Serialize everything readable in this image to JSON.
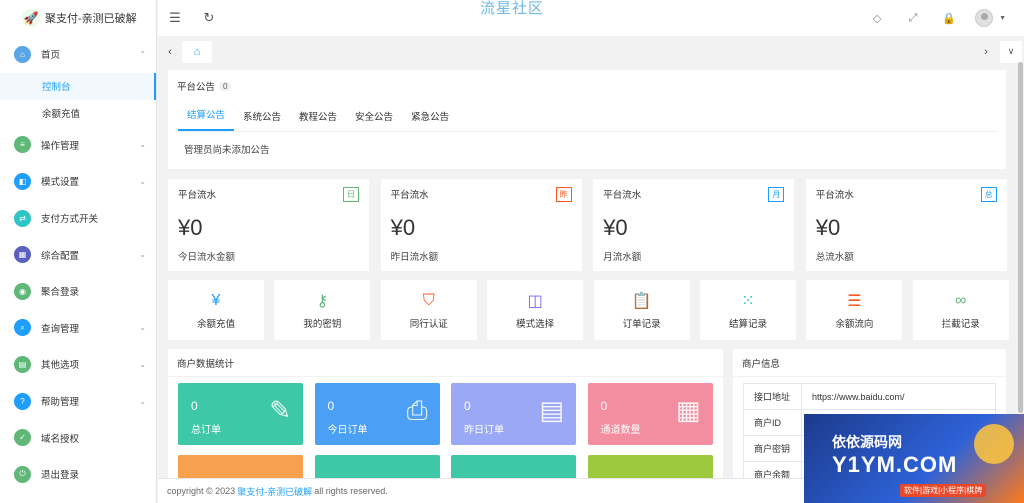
{
  "app": {
    "title": "聚支付-亲测已破解",
    "watermark": "流星社区"
  },
  "sidebar": {
    "items": [
      {
        "label": "首页",
        "icon": "home-icon",
        "color": "#5aa5e6",
        "expanded": true
      },
      {
        "label": "操作管理",
        "icon": "operation-icon",
        "color": "#5fb878"
      },
      {
        "label": "模式设置",
        "icon": "mode-icon",
        "color": "#1e9fff"
      },
      {
        "label": "支付方式开关",
        "icon": "toggle-icon",
        "color": "#2ec5c5"
      },
      {
        "label": "综合配置",
        "icon": "config-icon",
        "color": "#5a5fc0"
      },
      {
        "label": "聚合登录",
        "icon": "login-icon",
        "color": "#5fb878"
      },
      {
        "label": "查询管理",
        "icon": "search-icon",
        "color": "#1e9fff"
      },
      {
        "label": "其他选项",
        "icon": "options-icon",
        "color": "#5fb878"
      },
      {
        "label": "帮助管理",
        "icon": "help-icon",
        "color": "#1e9fff"
      },
      {
        "label": "域名授权",
        "icon": "domain-icon",
        "color": "#5fb878"
      },
      {
        "label": "退出登录",
        "icon": "logout-icon",
        "color": "#5fb878"
      }
    ],
    "subitems": [
      "控制台",
      "余额充值"
    ]
  },
  "notice": {
    "title": "平台公告",
    "count": "0",
    "tabs": [
      "结算公告",
      "系统公告",
      "教程公告",
      "安全公告",
      "紧急公告"
    ],
    "content": "管理员尚未添加公告"
  },
  "stats": [
    {
      "title": "平台流水",
      "tag": "日",
      "value": "¥0",
      "sub": "今日流水金额",
      "color": "#5fb878"
    },
    {
      "title": "平台流水",
      "tag": "昨",
      "value": "¥0",
      "sub": "昨日流水额",
      "color": "#ff5722"
    },
    {
      "title": "平台流水",
      "tag": "月",
      "value": "¥0",
      "sub": "月流水额",
      "color": "#1e9fff"
    },
    {
      "title": "平台流水",
      "tag": "总",
      "value": "¥0",
      "sub": "总流水额",
      "color": "#1e9fff"
    }
  ],
  "tools": [
    {
      "label": "余额充值",
      "icon": "yen-icon",
      "color": "#1e9fff"
    },
    {
      "label": "我的密钥",
      "icon": "key-icon",
      "color": "#5fb878"
    },
    {
      "label": "同行认证",
      "icon": "shield-icon",
      "color": "#ff5722"
    },
    {
      "label": "模式选择",
      "icon": "grid-icon",
      "color": "#7b61ff"
    },
    {
      "label": "订单记录",
      "icon": "clipboard-icon",
      "color": "#ffb800"
    },
    {
      "label": "结算记录",
      "icon": "dots-icon",
      "color": "#2ec5c5"
    },
    {
      "label": "余额流向",
      "icon": "sliders-icon",
      "color": "#ff5722"
    },
    {
      "label": "拦截记录",
      "icon": "infinity-icon",
      "color": "#5fb878"
    }
  ],
  "merchant_stats": {
    "title": "商户数据统计",
    "tiles": [
      {
        "value": "0",
        "label": "总订单",
        "color": "#3ec8a7",
        "icon": "edit-icon"
      },
      {
        "value": "0",
        "label": "今日订单",
        "color": "#4b9ff5",
        "icon": "printer-icon"
      },
      {
        "value": "0",
        "label": "昨日订单",
        "color": "#9aa8f5",
        "icon": "document-icon"
      },
      {
        "value": "0",
        "label": "通道数量",
        "color": "#f38ea0",
        "icon": "calendar-icon"
      }
    ],
    "tiles_row2_colors": [
      "#f7a14e",
      "#3ec8a7",
      "#3ec8a7",
      "#9dc93e"
    ]
  },
  "merchant": {
    "title": "商户信息",
    "rows": [
      {
        "key": "接口地址",
        "value": "https://www.baidu.com/"
      },
      {
        "key": "商户ID",
        "value": ""
      },
      {
        "key": "商户密钥",
        "value": ""
      },
      {
        "key": "商户余额",
        "value": ""
      }
    ]
  },
  "footer": {
    "prefix": "copyright © 2023",
    "site": "聚支付-亲测已破解",
    "suffix": "all rights reserved."
  },
  "promo": {
    "line1": "依依源码网",
    "line2": "Y1YM.COM",
    "line3": "软件|游戏|小程序|棋牌"
  }
}
